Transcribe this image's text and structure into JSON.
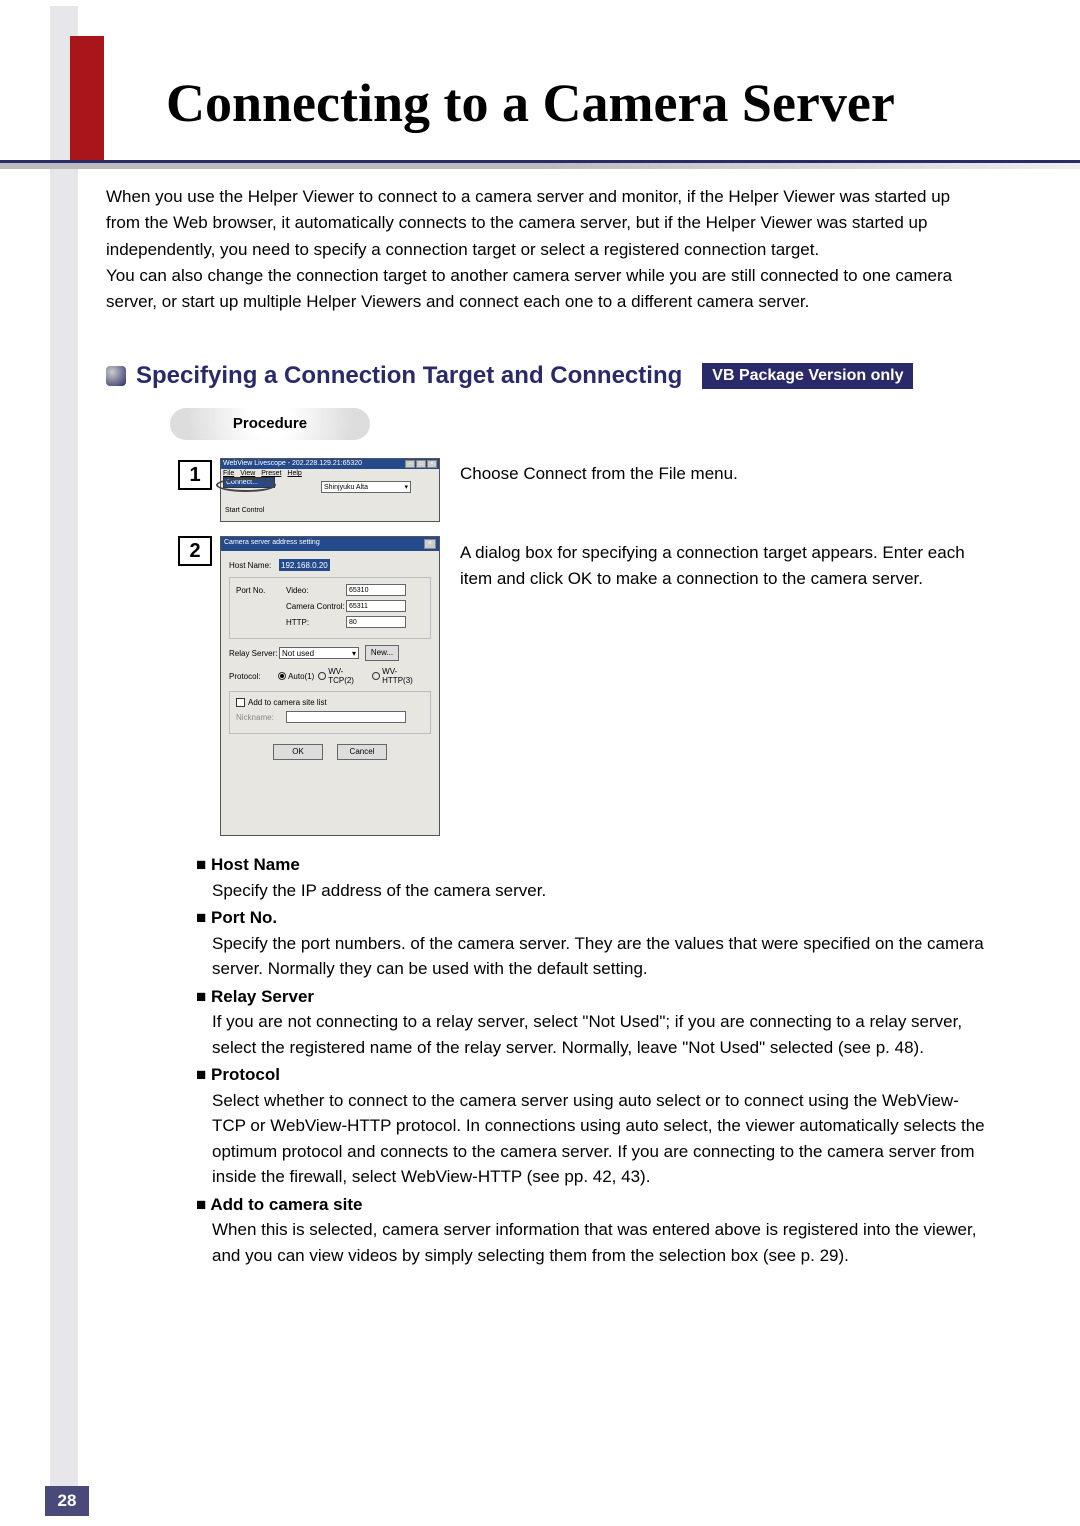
{
  "page": {
    "title": "Connecting to a Camera Server",
    "intro": "When you use the Helper Viewer to connect to a camera server and monitor, if the Helper Viewer was started up from the Web browser, it automatically connects to the camera server, but if the Helper Viewer was started up independently, you need to specify a connection target or select a registered connection target.\nYou can also change the connection target to another camera server while you are still connected to one camera server, or start up multiple Helper Viewers and connect each one to a different camera server.",
    "section_heading": "Specifying a Connection Target and Connecting",
    "badge": "VB Package Version only",
    "procedure_label": "Procedure",
    "page_number": "28"
  },
  "step1": {
    "num": "1",
    "text": "Choose Connect from the File menu.",
    "window": {
      "title": "WebView Livescope - 202.228.129.21:65320",
      "menu_file": "File",
      "menu_view": "View",
      "menu_preset": "Preset",
      "menu_help": "Help",
      "menu_item_connect": "Connect...",
      "menu_item_start": "Start Control",
      "camera_select": "Shinjyuku Alta"
    }
  },
  "step2": {
    "num": "2",
    "text": "A dialog box for specifying a connection target appears. Enter each item and click OK to make a connection to the camera server.",
    "dialog": {
      "title": "Camera server address setting",
      "host_label": "Host Name:",
      "host_value": "192.168.0.20",
      "portno_label": "Port No.",
      "video_label": "Video:",
      "video_value": "65310",
      "camctrl_label": "Camera Control:",
      "camctrl_value": "65311",
      "http_label": "HTTP:",
      "http_value": "80",
      "relay_label": "Relay Server:",
      "relay_value": "Not used",
      "new_btn": "New...",
      "protocol_label": "Protocol:",
      "proto_auto": "Auto(1)",
      "proto_tcp": "WV-TCP(2)",
      "proto_http": "WV-HTTP(3)",
      "addsite_label": "Add to camera site list",
      "nickname_label": "Nickname:",
      "ok_btn": "OK",
      "cancel_btn": "Cancel"
    }
  },
  "defs": {
    "host_name": {
      "term": "Host Name",
      "desc": "Specify the IP address of the camera server."
    },
    "port_no": {
      "term": "Port No.",
      "desc": "Specify the port numbers. of the camera server. They are the values that were specified on the camera server. Normally they can be used with the default setting."
    },
    "relay": {
      "term": "Relay Server",
      "desc": "If you are not connecting to a relay server, select \"Not Used\"; if you are connecting to a relay server, select the registered name of the relay server. Normally, leave \"Not Used\" selected (see p. 48)."
    },
    "protocol": {
      "term": "Protocol",
      "desc": "Select whether to connect to the camera server using auto select or to connect using the WebView-TCP or WebView-HTTP protocol. In connections using auto select, the viewer automatically selects the optimum protocol and connects to the camera server. If you are connecting to the camera server from inside the firewall, select WebView-HTTP (see pp. 42, 43)."
    },
    "addsite": {
      "term": "Add to camera site",
      "desc": "When this is selected, camera server information that was entered above is registered into the viewer, and you can view videos by simply selecting them from the selection box (see p. 29)."
    }
  }
}
